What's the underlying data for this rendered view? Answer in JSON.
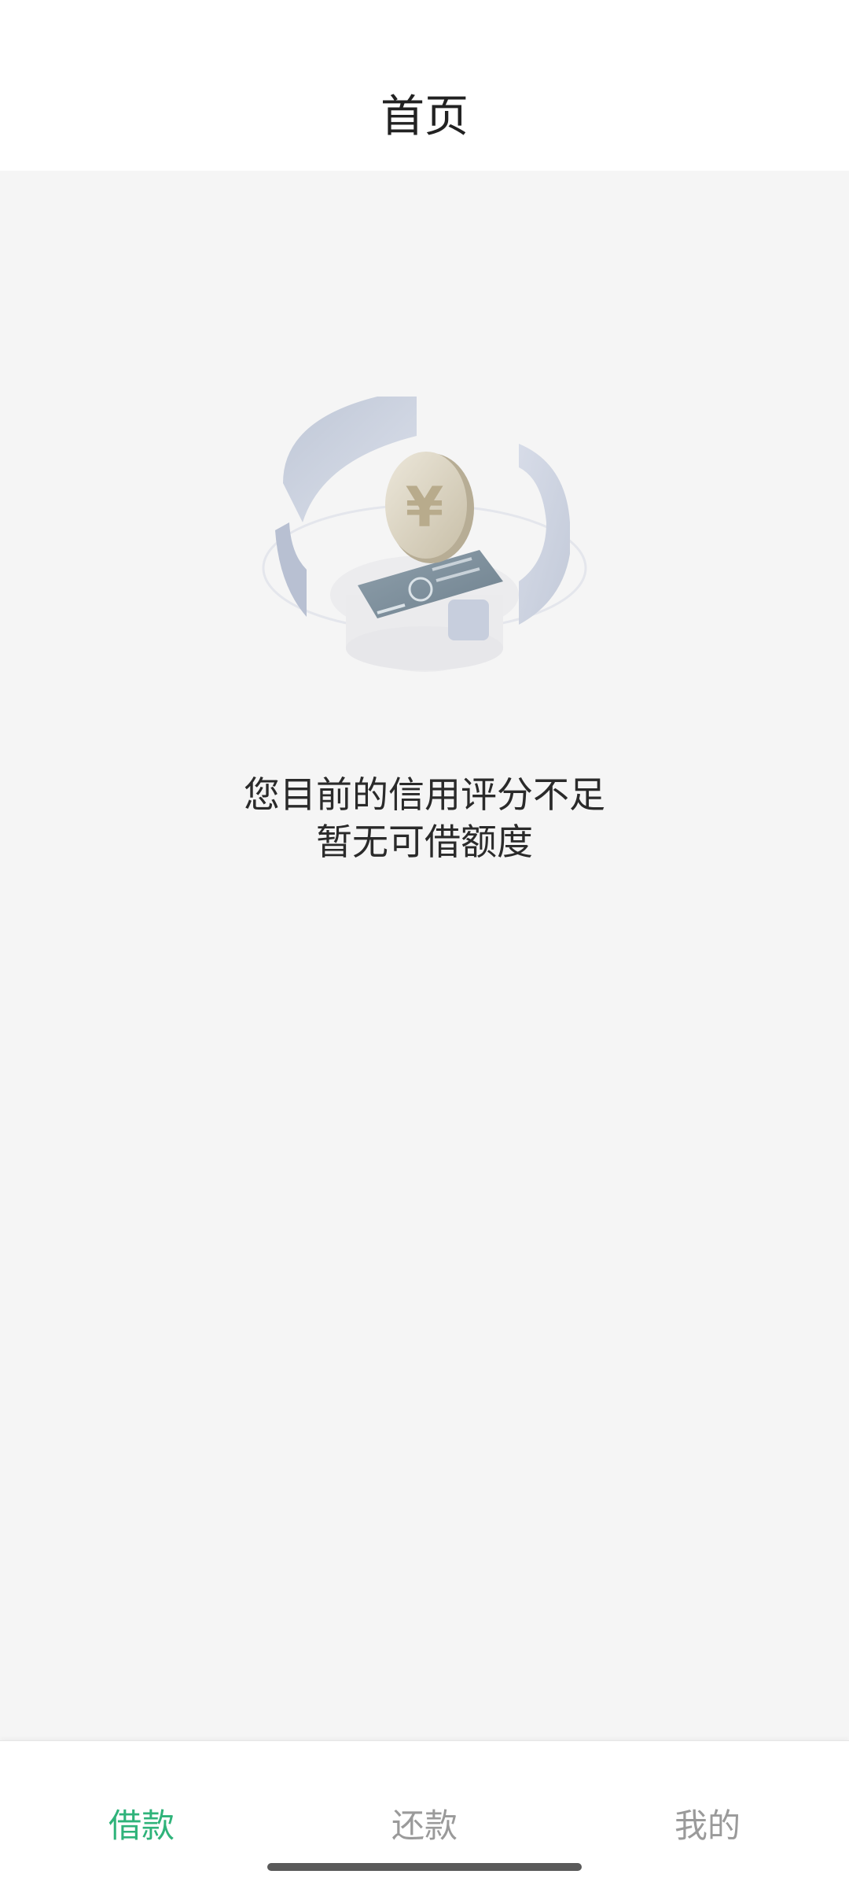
{
  "header": {
    "title": "首页"
  },
  "empty_state": {
    "line1": "您目前的信用评分不足",
    "line2": "暂无可借额度"
  },
  "tabs": [
    {
      "label": "借款",
      "active": true
    },
    {
      "label": "还款",
      "active": false
    },
    {
      "label": "我的",
      "active": false
    }
  ],
  "colors": {
    "accent": "#2fb37a",
    "inactive_tab": "#9a9a9a",
    "background": "#f5f5f5"
  },
  "icons": {
    "illustration": "yuan-coin-card-illustration"
  }
}
